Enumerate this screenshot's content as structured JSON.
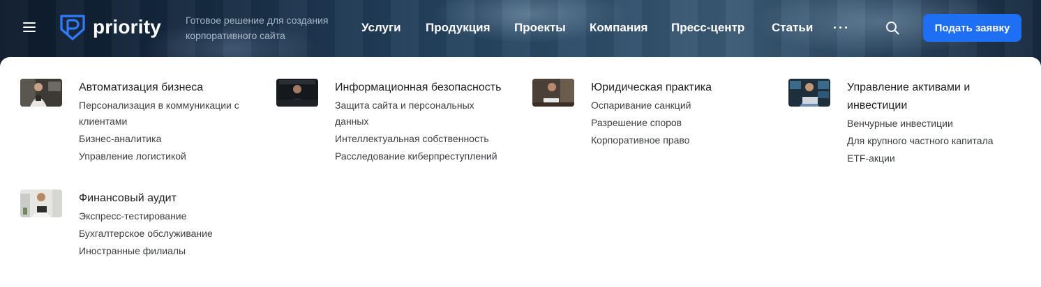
{
  "header": {
    "logo_text": "priority",
    "tagline": "Готовое решение для создания корпоративного сайта",
    "nav": [
      "Услуги",
      "Продукция",
      "Проекты",
      "Компания",
      "Пресс-центр",
      "Статьи"
    ],
    "more_icon": "ellipsis-icon",
    "search_icon": "search-icon",
    "cta_label": "Подать заявку",
    "colors": {
      "accent": "#1f6ff5",
      "nav_text": "#ffffff",
      "tagline": "#a9b8c7"
    }
  },
  "menu": {
    "categories": [
      {
        "title": "Автоматизация бизнеса",
        "links": [
          "Персонализация в коммуникации с клиентами",
          "Бизнес-аналитика",
          "Управление логистикой"
        ]
      },
      {
        "title": "Информационная безопасность",
        "links": [
          "Защита сайта и персональных данных",
          "Интеллектуальная собственность",
          "Расследование киберпреступлений"
        ]
      },
      {
        "title": "Юридическая практика",
        "links": [
          "Оспаривание санкций",
          "Разрешение споров",
          "Корпоративное право"
        ]
      },
      {
        "title": "Управление активами и инвестиции",
        "links": [
          "Венчурные инвестиции",
          "Для крупного частного капитала",
          "ETF-акции"
        ]
      },
      {
        "title": "Финансовый аудит",
        "links": [
          "Экспресс-тестирование",
          "Бухгалтерское обслуживание",
          "Иностранные филиалы"
        ]
      }
    ]
  }
}
